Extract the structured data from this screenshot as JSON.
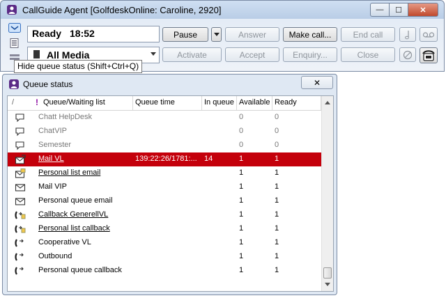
{
  "window": {
    "title": "CallGuide Agent [GolfdeskOnline: Caroline, 2920]",
    "minimize_glyph": "—",
    "maximize_glyph": "☐",
    "close_glyph": "✕"
  },
  "status": {
    "state": "Ready",
    "time": "18:52"
  },
  "media": {
    "selected": "All Media"
  },
  "buttons": {
    "pause": "Pause",
    "answer": "Answer",
    "make_call": "Make call...",
    "end_call": "End call",
    "activate": "Activate",
    "accept": "Accept",
    "enquiry": "Enquiry...",
    "close": "Close"
  },
  "tooltip": "Hide queue status (Shift+Ctrl+Q)",
  "queue_window": {
    "title": "Queue status",
    "close_glyph": "✕",
    "headers": {
      "sort": "/",
      "priority": "!",
      "queue": "Queue/Waiting list",
      "queue_time": "Queue time",
      "in_queue": "In queue",
      "available": "Available",
      "ready": "Ready"
    },
    "rows": [
      {
        "icon": "chat-icon",
        "name": "Chatt HelpDesk",
        "queue_time": "",
        "in_queue": "",
        "available": "0",
        "ready": "0"
      },
      {
        "icon": "chat-icon",
        "name": "ChatVIP",
        "queue_time": "",
        "in_queue": "",
        "available": "0",
        "ready": "0"
      },
      {
        "icon": "chat-icon",
        "name": "Semester",
        "queue_time": "",
        "in_queue": "",
        "available": "0",
        "ready": "0"
      },
      {
        "icon": "email-pending-icon",
        "name": "Mail VL",
        "queue_time": "139:22:26/1781:...",
        "in_queue": "14",
        "available": "1",
        "ready": "1"
      },
      {
        "icon": "email-personal-icon",
        "name": "Personal list email",
        "queue_time": "",
        "in_queue": "",
        "available": "1",
        "ready": "1"
      },
      {
        "icon": "email-icon",
        "name": "Mail VIP",
        "queue_time": "",
        "in_queue": "",
        "available": "1",
        "ready": "1"
      },
      {
        "icon": "email-icon",
        "name": "Personal queue email",
        "queue_time": "",
        "in_queue": "",
        "available": "1",
        "ready": "1"
      },
      {
        "icon": "callback-list-icon",
        "name": "Callback GenerellVL",
        "queue_time": "",
        "in_queue": "",
        "available": "1",
        "ready": "1"
      },
      {
        "icon": "callback-list-icon",
        "name": "Personal list callback",
        "queue_time": "",
        "in_queue": "",
        "available": "1",
        "ready": "1"
      },
      {
        "icon": "phone-icon",
        "name": "Cooperative VL",
        "queue_time": "",
        "in_queue": "",
        "available": "1",
        "ready": "1"
      },
      {
        "icon": "phone-icon",
        "name": "Outbound",
        "queue_time": "",
        "in_queue": "",
        "available": "1",
        "ready": "1"
      },
      {
        "icon": "phone-icon",
        "name": "Personal queue callback",
        "queue_time": "",
        "in_queue": "",
        "available": "1",
        "ready": "1"
      }
    ]
  },
  "colors": {
    "selected_row": "#c4000b",
    "priority_mark": "#8b0aa0"
  }
}
